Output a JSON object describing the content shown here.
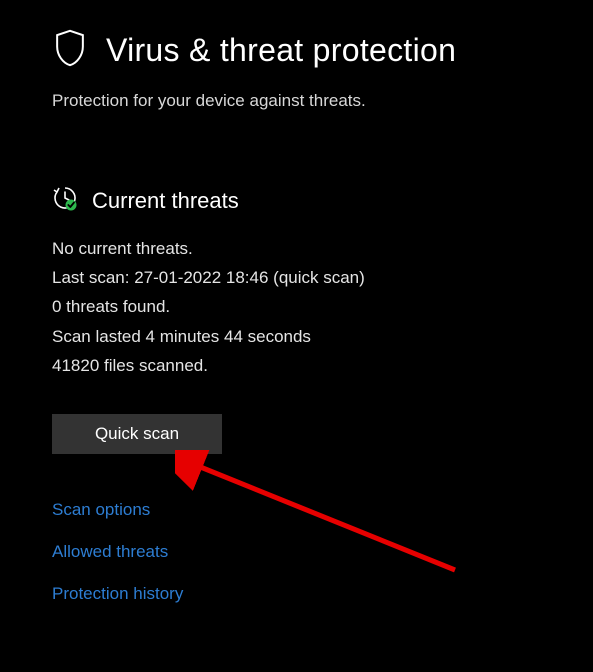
{
  "header": {
    "title": "Virus & threat protection",
    "subtitle": "Protection for your device against threats."
  },
  "section": {
    "title": "Current threats",
    "status_no_threats": "No current threats.",
    "last_scan": "Last scan: 27-01-2022 18:46 (quick scan)",
    "threats_found": "0 threats found.",
    "scan_duration": "Scan lasted 4 minutes 44 seconds",
    "files_scanned": "41820 files scanned."
  },
  "buttons": {
    "quick_scan": "Quick scan"
  },
  "links": {
    "scan_options": "Scan options",
    "allowed_threats": "Allowed threats",
    "protection_history": "Protection history"
  }
}
